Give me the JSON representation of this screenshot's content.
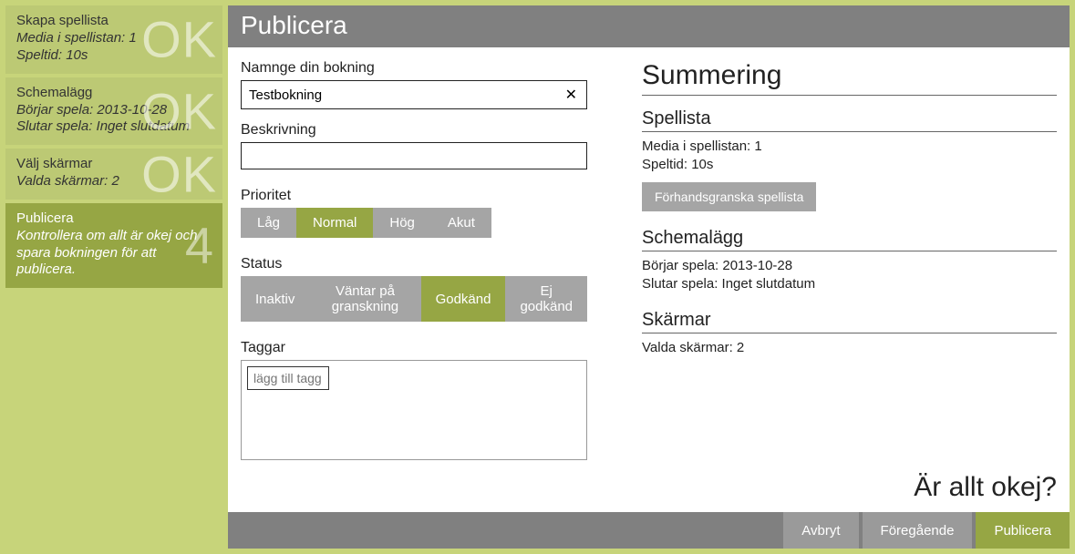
{
  "sidebar": {
    "steps": [
      {
        "title": "Skapa spellista",
        "desc": "Media i spellistan: 1\nSpeltid: 10s",
        "marker": "OK"
      },
      {
        "title": "Schemalägg",
        "desc": "Börjar spela: 2013-10-28\nSlutar spela: Inget slutdatum",
        "marker": "OK"
      },
      {
        "title": "Välj skärmar",
        "desc": "Valda skärmar: 2",
        "marker": "OK"
      },
      {
        "title": "Publicera",
        "desc": "Kontrollera om allt är okej och spara bokningen för att publicera.",
        "marker": "4"
      }
    ]
  },
  "header": {
    "title": "Publicera"
  },
  "form": {
    "name_label": "Namnge din bokning",
    "name_value": "Testbokning",
    "desc_label": "Beskrivning",
    "priority_label": "Prioritet",
    "priority_options": [
      "Låg",
      "Normal",
      "Hög",
      "Akut"
    ],
    "priority_selected": "Normal",
    "status_label": "Status",
    "status_options": [
      "Inaktiv",
      "Väntar på granskning",
      "Godkänd",
      "Ej godkänd"
    ],
    "status_selected": "Godkänd",
    "tags_label": "Taggar",
    "tags_placeholder": "lägg till tagg"
  },
  "summary": {
    "title": "Summering",
    "playlist": {
      "head": "Spellista",
      "line1": "Media i spellistan: 1",
      "line2": "Speltid: 10s",
      "preview": "Förhandsgranska spellista"
    },
    "schedule": {
      "head": "Schemalägg",
      "line1": "Börjar spela: 2013-10-28",
      "line2": "Slutar spela: Inget slutdatum"
    },
    "screens": {
      "head": "Skärmar",
      "line1": "Valda skärmar: 2"
    }
  },
  "okay": "Är allt okej?",
  "footer": {
    "cancel": "Avbryt",
    "prev": "Föregående",
    "publish": "Publicera"
  }
}
